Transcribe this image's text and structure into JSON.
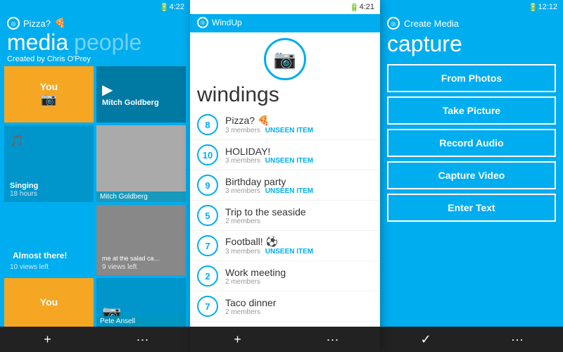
{
  "panel1": {
    "status_time": "4:22",
    "app_name": "Pizza?",
    "tab_active": "media",
    "tab_inactive": "people",
    "created_by": "Created by Chris O'Prey",
    "tile_you_label": "You",
    "tile_mitch": "Mitch Goldberg",
    "tile_singing": "Singing",
    "tile_singing_sub": "18 hours",
    "tile_mitch2": "Mitch Goldberg",
    "tile_almost": "Almost there!",
    "tile_almost_sub": "10 views left",
    "tile_salad": "me at the salad ca…",
    "tile_salad_sub": "9 views left",
    "tile_you2": "You",
    "tile_pete": "Pete Ansell",
    "bottom_add": "+",
    "bottom_dots": "···"
  },
  "panel2": {
    "status_time": "4:21",
    "app_name": "WindUp",
    "title": "windings",
    "camera_icon": "📷",
    "items": [
      {
        "badge": "8",
        "title": "Pizza?",
        "emoji": "🍕",
        "members": "3 members",
        "unseen": "UNSEEN ITEM"
      },
      {
        "badge": "10",
        "title": "HOLIDAY!",
        "emoji": "",
        "members": "3 members",
        "unseen": "UNSEEN ITEM"
      },
      {
        "badge": "9",
        "title": "Birthday party",
        "emoji": "",
        "members": "3 members",
        "unseen": "UNSEEN ITEM"
      },
      {
        "badge": "5",
        "title": "Trip to the seaside",
        "emoji": "",
        "members": "2 members",
        "unseen": ""
      },
      {
        "badge": "7",
        "title": "Football!",
        "emoji": "⚽",
        "members": "3 members",
        "unseen": "UNSEEN ITEM"
      },
      {
        "badge": "2",
        "title": "Work meeting",
        "emoji": "",
        "members": "2 members",
        "unseen": ""
      },
      {
        "badge": "7",
        "title": "Taco dinner",
        "emoji": "",
        "members": "2 members",
        "unseen": ""
      }
    ],
    "bottom_add": "+",
    "bottom_dots": "···"
  },
  "panel3": {
    "status_time": "12:12",
    "app_name": "Create Media",
    "title": "capture",
    "buttons": [
      "From Photos",
      "Take Picture",
      "Record Audio",
      "Capture Video",
      "Enter Text"
    ],
    "bottom_check": "✓",
    "bottom_dots": "···"
  }
}
